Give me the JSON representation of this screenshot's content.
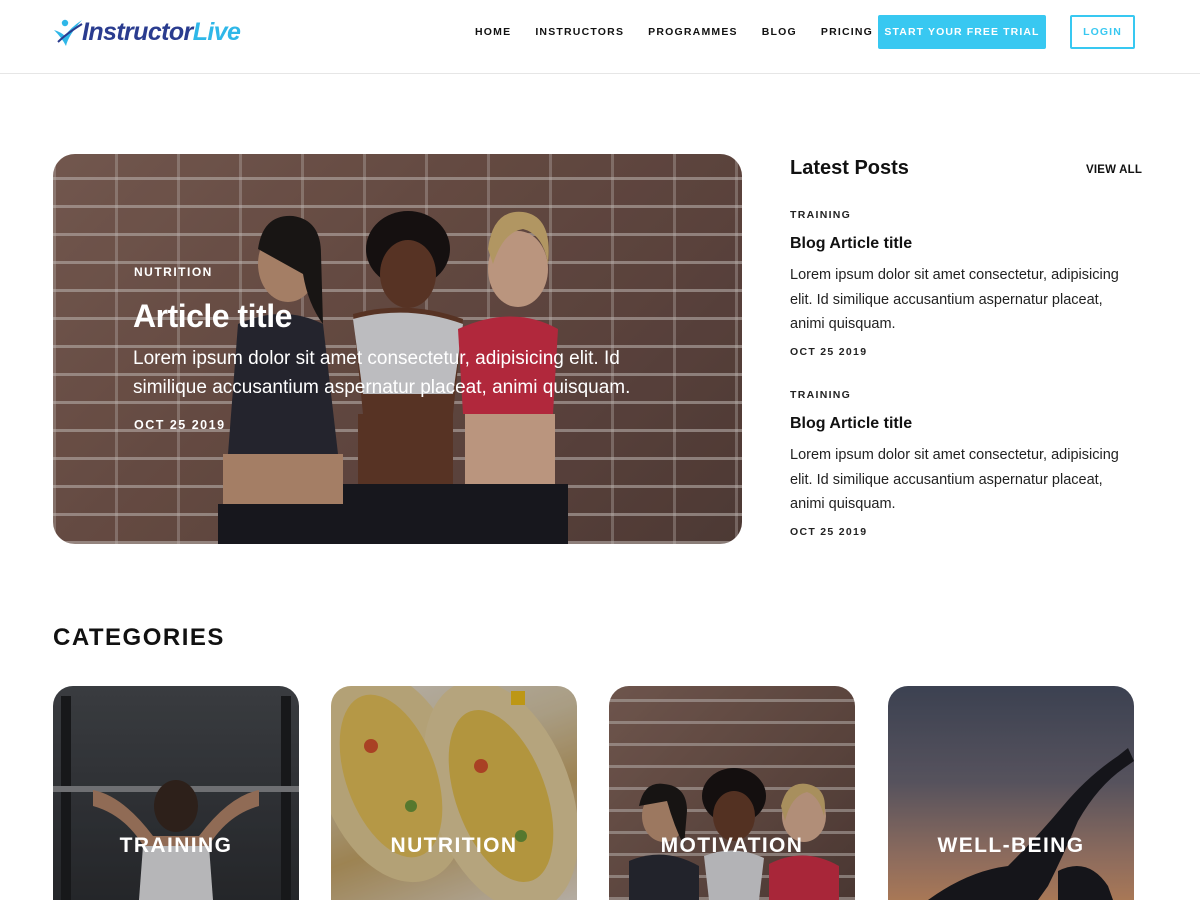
{
  "brand": {
    "name_part1": "Instructor",
    "name_part2": "Live",
    "colors": {
      "accent": "#38c8f1",
      "logo_dark": "#2a3c8f",
      "logo_light": "#2fb7e8"
    }
  },
  "nav": {
    "items": [
      "HOME",
      "INSTRUCTORS",
      "PROGRAMMES",
      "BLOG",
      "PRICING"
    ],
    "trial_label": "START YOUR FREE TRIAL",
    "login_label": "LOGIN"
  },
  "hero": {
    "category": "NUTRITION",
    "title": "Article title",
    "excerpt": "Lorem ipsum dolor sit amet consectetur, adipisicing elit. Id similique accusantium aspernatur placeat, animi quisquam.",
    "date": "OCT 25 2019"
  },
  "latest": {
    "heading": "Latest Posts",
    "view_all": "VIEW ALL",
    "posts": [
      {
        "category": "TRAINING",
        "title": "Blog Article title",
        "excerpt": "Lorem ipsum dolor sit amet consectetur, adipisicing elit. Id similique accusantium aspernatur placeat, animi quisquam.",
        "date": "OCT 25 2019"
      },
      {
        "category": "TRAINING",
        "title": "Blog Article title",
        "excerpt": "Lorem ipsum dolor sit amet consectetur, adipisicing elit. Id similique accusantium aspernatur placeat, animi quisquam.",
        "date": "OCT 25 2019"
      }
    ]
  },
  "categories": {
    "heading": "CATEGORIES",
    "items": [
      {
        "label": "TRAINING"
      },
      {
        "label": "NUTRITION"
      },
      {
        "label": "MOTIVATION"
      },
      {
        "label": "WELL-BEING"
      }
    ]
  }
}
